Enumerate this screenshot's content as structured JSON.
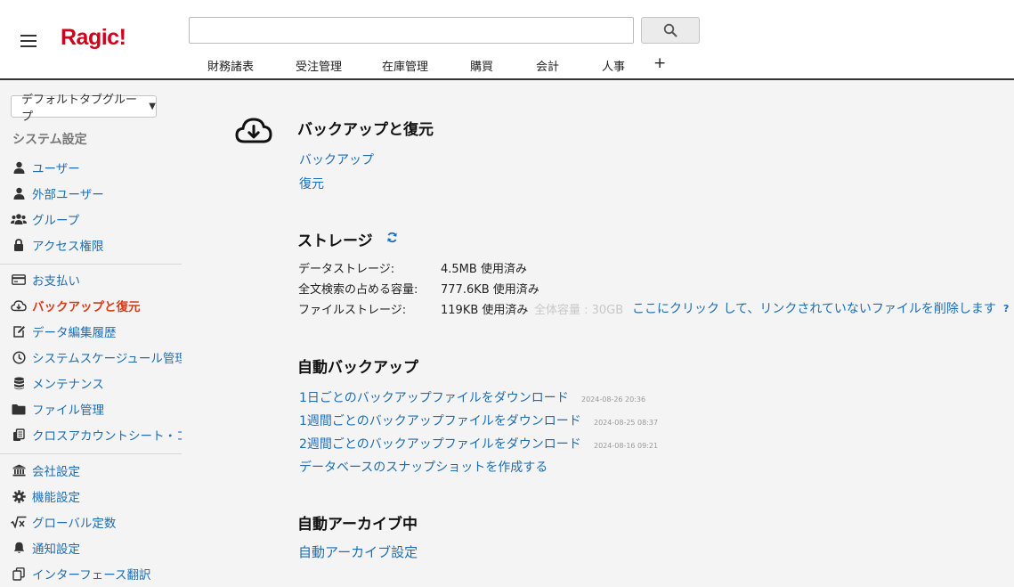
{
  "header": {
    "logo": "Ragic!",
    "search": {
      "value": "",
      "placeholder": ""
    },
    "tabs": [
      "財務諸表",
      "受注管理",
      "在庫管理",
      "購買",
      "会計",
      "人事"
    ],
    "add_tab": "+"
  },
  "sidebar": {
    "tab_group": "デフォルトタブグループ",
    "section_title": "システム設定",
    "items": [
      {
        "label": "ユーザー",
        "icon": "user-icon"
      },
      {
        "label": "外部ユーザー",
        "icon": "external-user-icon"
      },
      {
        "label": "グループ",
        "icon": "group-icon"
      },
      {
        "label": "アクセス権限",
        "icon": "lock-icon"
      },
      {
        "label": "お支払い",
        "icon": "credit-card-icon"
      },
      {
        "label": "バックアップと復元",
        "icon": "cloud-download-icon",
        "active": true
      },
      {
        "label": "データ編集履歴",
        "icon": "edit-icon"
      },
      {
        "label": "システムスケージュール管理",
        "icon": "clock-icon"
      },
      {
        "label": "メンテナンス",
        "icon": "database-icon"
      },
      {
        "label": "ファイル管理",
        "icon": "folder-icon"
      },
      {
        "label": "クロスアカウントシート・コ",
        "icon": "copy-sheets-icon"
      },
      {
        "label": "会社設定",
        "icon": "bank-icon"
      },
      {
        "label": "機能設定",
        "icon": "gear-icon"
      },
      {
        "label": "グローバル定数",
        "icon": "sqrt-icon"
      },
      {
        "label": "通知設定",
        "icon": "bell-icon"
      },
      {
        "label": "インターフェース翻訳",
        "icon": "translate-icon"
      }
    ]
  },
  "main": {
    "backup_title": "バックアップと復元",
    "backup_link": "バックアップ",
    "restore_link": "復元",
    "storage": {
      "title": "ストレージ",
      "rows": [
        {
          "label": "データストレージ:",
          "value": "4.5MB 使用済み"
        },
        {
          "label": "全文検索の占める容量:",
          "value": "777.6KB 使用済み"
        },
        {
          "label": "ファイルストレージ:",
          "value": "119KB 使用済み"
        }
      ],
      "total": "全体容量 : 30GB",
      "cleanup_link": "ここにクリック して、リンクされていないファイルを削除します",
      "help": "?"
    },
    "auto_backup": {
      "title": "自動バックアップ",
      "downloads": [
        {
          "label": "1日ごとのバックアップファイルをダウンロード",
          "time": "2024-08-26 20:36"
        },
        {
          "label": "1週間ごとのバックアップファイルをダウンロード",
          "time": "2024-08-25 08:37"
        },
        {
          "label": "2週間ごとのバックアップファイルをダウンロード",
          "time": "2024-08-16 09:21"
        }
      ],
      "snapshot_link": "データベースのスナップショットを作成する"
    },
    "auto_archive": {
      "title": "自動アーカイブ中",
      "settings_link": "自動アーカイブ設定"
    }
  },
  "colors": {
    "accent": "#d23f1b",
    "link": "#1e6db2",
    "logo": "#d0021b"
  }
}
